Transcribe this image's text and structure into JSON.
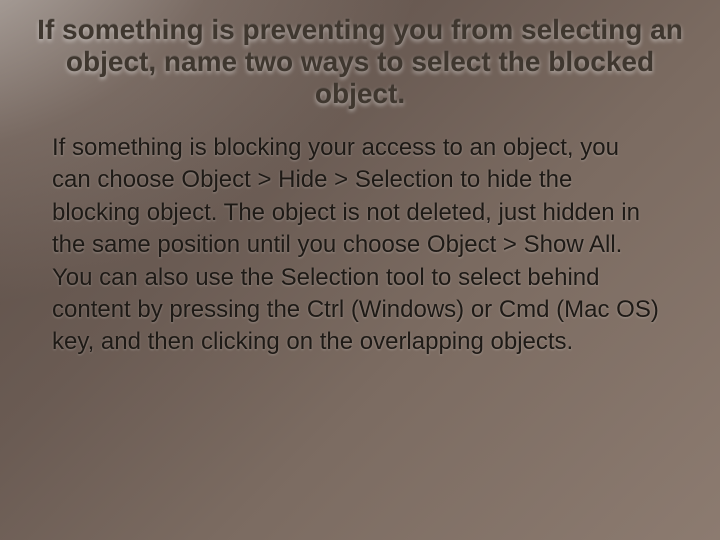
{
  "slide": {
    "title": "If something is preventing you from selecting an object, name two ways to select the blocked object.",
    "body": "If something is blocking your access to an object, you can choose Object > Hide > Selection to hide the blocking object. The object is not deleted, just hidden in the same position until you choose Object > Show All. You can also use the Selection tool to select behind content by pressing the Ctrl (Windows) or Cmd (Mac OS) key, and then clicking on the overlapping objects."
  }
}
